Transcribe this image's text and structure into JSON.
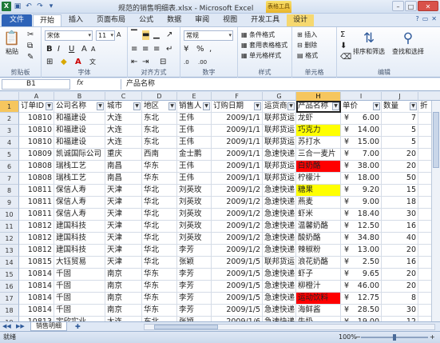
{
  "window": {
    "title": "规范的销售明细表.xlsx - Microsoft Excel",
    "context_tab_group": "表格工具"
  },
  "tabs": [
    "文件",
    "开始",
    "插入",
    "页面布局",
    "公式",
    "数据",
    "审阅",
    "视图",
    "开发工具",
    "设计"
  ],
  "ribbon": {
    "clipboard": {
      "label": "剪贴板",
      "paste": "粘贴"
    },
    "font": {
      "label": "字体",
      "name": "宋体",
      "size": "11"
    },
    "alignment": {
      "label": "对齐方式"
    },
    "number": {
      "label": "数字",
      "format": "常规"
    },
    "styles": {
      "label": "样式",
      "items": [
        "条件格式",
        "套用表格格式",
        "单元格样式"
      ]
    },
    "cells": {
      "label": "单元格",
      "items": [
        "插入",
        "删除",
        "格式"
      ]
    },
    "editing": {
      "label": "编辑",
      "sort": "排序和筛选",
      "find": "查找和选择"
    }
  },
  "formula_bar": {
    "name_box": "B1",
    "fx": "fx",
    "content": "产品名称"
  },
  "columns": [
    "A",
    "B",
    "C",
    "D",
    "E",
    "F",
    "G",
    "H",
    "I",
    "J"
  ],
  "selected_column": "H",
  "headers": [
    "订单ID",
    "公司名称",
    "城市",
    "地区",
    "销售人",
    "订购日期",
    "运货商",
    "产品名称",
    "单价",
    "数量",
    "折"
  ],
  "rows": [
    {
      "r": "2",
      "id": "10810",
      "company": "和福建设",
      "city": "大连",
      "region": "东北",
      "sales": "王伟",
      "date": "2009/1/1",
      "ship": "联邦货运",
      "product": "龙虾",
      "hl": "",
      "price": "6.00",
      "qty": "7"
    },
    {
      "r": "3",
      "id": "10810",
      "company": "和福建设",
      "city": "大连",
      "region": "东北",
      "sales": "王伟",
      "date": "2009/1/1",
      "ship": "联邦货运",
      "product": "巧克力",
      "hl": "yellow",
      "price": "14.00",
      "qty": "5"
    },
    {
      "r": "4",
      "id": "10810",
      "company": "和福建设",
      "city": "大连",
      "region": "东北",
      "sales": "王伟",
      "date": "2009/1/1",
      "ship": "联邦货运",
      "product": "苏打水",
      "hl": "",
      "price": "15.00",
      "qty": "5"
    },
    {
      "r": "5",
      "id": "10809",
      "company": "凯诚国际公司",
      "city": "重庆",
      "region": "西南",
      "sales": "金士鹏",
      "date": "2009/1/1",
      "ship": "急速快递",
      "product": "三合一麦片",
      "hl": "",
      "price": "7.00",
      "qty": "20"
    },
    {
      "r": "6",
      "id": "10808",
      "company": "瑞栈工艺",
      "city": "南昌",
      "region": "华东",
      "sales": "王伟",
      "date": "2009/1/1",
      "ship": "联邦货运",
      "product": "白奶酪",
      "hl": "red",
      "price": "38.00",
      "qty": "20"
    },
    {
      "r": "7",
      "id": "10808",
      "company": "瑞栈工艺",
      "city": "南昌",
      "region": "华东",
      "sales": "王伟",
      "date": "2009/1/1",
      "ship": "联邦货运",
      "product": "柠檬汁",
      "hl": "",
      "price": "18.00",
      "qty": "50"
    },
    {
      "r": "8",
      "id": "10811",
      "company": "保信人寿",
      "city": "天津",
      "region": "华北",
      "sales": "刘英玫",
      "date": "2009/1/2",
      "ship": "急速快递",
      "product": "糖果",
      "hl": "yellow",
      "price": "9.20",
      "qty": "15"
    },
    {
      "r": "9",
      "id": "10811",
      "company": "保信人寿",
      "city": "天津",
      "region": "华北",
      "sales": "刘英玫",
      "date": "2009/1/2",
      "ship": "急速快递",
      "product": "燕麦",
      "hl": "",
      "price": "9.00",
      "qty": "18"
    },
    {
      "r": "10",
      "id": "10811",
      "company": "保信人寿",
      "city": "天津",
      "region": "华北",
      "sales": "刘英玫",
      "date": "2009/1/2",
      "ship": "急速快递",
      "product": "虾米",
      "hl": "",
      "price": "18.40",
      "qty": "30"
    },
    {
      "r": "11",
      "id": "10812",
      "company": "建国科技",
      "city": "天津",
      "region": "华北",
      "sales": "刘英玫",
      "date": "2009/1/2",
      "ship": "急速快递",
      "product": "温馨奶酪",
      "hl": "",
      "price": "12.50",
      "qty": "16"
    },
    {
      "r": "12",
      "id": "10812",
      "company": "建国科技",
      "city": "天津",
      "region": "华北",
      "sales": "刘英玫",
      "date": "2009/1/2",
      "ship": "急速快递",
      "product": "酸奶酪",
      "hl": "",
      "price": "34.80",
      "qty": "40"
    },
    {
      "r": "13",
      "id": "10812",
      "company": "建国科技",
      "city": "天津",
      "region": "华北",
      "sales": "李芳",
      "date": "2009/1/2",
      "ship": "急速快递",
      "product": "辣椒粉",
      "hl": "",
      "price": "13.00",
      "qty": "20"
    },
    {
      "r": "14",
      "id": "10815",
      "company": "大钰贸易",
      "city": "天津",
      "region": "华北",
      "sales": "张颖",
      "date": "2009/1/5",
      "ship": "联邦货运",
      "product": "浪花奶酪",
      "hl": "",
      "price": "2.50",
      "qty": "16"
    },
    {
      "r": "15",
      "id": "10814",
      "company": "千固",
      "city": "南京",
      "region": "华东",
      "sales": "李芳",
      "date": "2009/1/5",
      "ship": "急速快递",
      "product": "虾子",
      "hl": "",
      "price": "9.65",
      "qty": "20"
    },
    {
      "r": "16",
      "id": "10814",
      "company": "千固",
      "city": "南京",
      "region": "华东",
      "sales": "李芳",
      "date": "2009/1/5",
      "ship": "急速快递",
      "product": "柳橙汁",
      "hl": "",
      "price": "46.00",
      "qty": "20"
    },
    {
      "r": "17",
      "id": "10814",
      "company": "千固",
      "city": "南京",
      "region": "华东",
      "sales": "李芳",
      "date": "2009/1/5",
      "ship": "急速快递",
      "product": "运动饮料",
      "hl": "red",
      "price": "12.75",
      "qty": "8"
    },
    {
      "r": "18",
      "id": "10814",
      "company": "千固",
      "city": "南京",
      "region": "华东",
      "sales": "李芳",
      "date": "2009/1/5",
      "ship": "急速快递",
      "product": "海鲜酱",
      "hl": "",
      "price": "28.50",
      "qty": "30"
    },
    {
      "r": "19",
      "id": "10813",
      "company": "宇欣实业",
      "city": "大连",
      "region": "东北",
      "sales": "张颖",
      "date": "2009/1/6",
      "ship": "急速快递",
      "product": "牛奶",
      "hl": "",
      "price": "19.00",
      "qty": "12"
    },
    {
      "r": "20",
      "id": "10813",
      "company": "宇欣实业",
      "city": "大连",
      "region": "东北",
      "sales": "张颖",
      "date": "2009/1/6",
      "ship": "急速快递",
      "product": "蟹",
      "hl": "",
      "price": "",
      "qty": ""
    }
  ],
  "header_row_number": "1",
  "currency_symbol": "¥",
  "highlight_colors": {
    "yellow": "#ffff00",
    "red": "#ff0000"
  },
  "sheet_tab": "销售明细",
  "status": {
    "ready": "就绪",
    "zoom": "100%"
  }
}
